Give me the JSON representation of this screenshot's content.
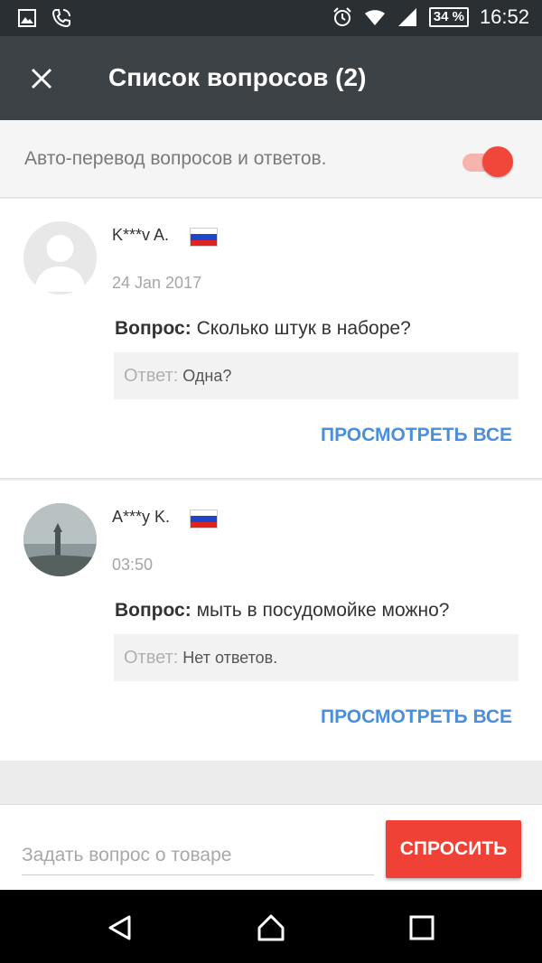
{
  "status_bar": {
    "time": "16:52",
    "battery": "34 %",
    "icons": [
      "image-icon",
      "phone-call-icon",
      "alarm-icon",
      "wifi-icon",
      "signal-icon"
    ]
  },
  "toolbar": {
    "title": "Список вопросов (2)",
    "close_icon": "close-icon"
  },
  "auto_translate": {
    "label": "Авто-перевод вопросов и ответов.",
    "enabled": true,
    "accent": "#f1473b"
  },
  "questions": [
    {
      "author": "K***v A.",
      "country": "Russia",
      "date": "24 Jan 2017",
      "question_label": "Вопрос:",
      "question_text": " Сколько штук в наборе?",
      "answer_label": "Ответ:",
      "answer_text": " Одна?",
      "view_all": "ПРОСМОТРЕТЬ ВСЕ"
    },
    {
      "author": "A***y K.",
      "country": "Russia",
      "date": "03:50",
      "question_label": "Вопрос:",
      "question_text": " мыть в посудомойке можно?",
      "answer_label": "Ответ:",
      "answer_text": " Нет ответов.",
      "view_all": "ПРОСМОТРЕТЬ ВСЕ"
    }
  ],
  "ask": {
    "placeholder": "Задать вопрос о товаре",
    "button": "СПРОСИТЬ",
    "button_color": "#ef4136"
  },
  "nav": {
    "buttons": [
      "back-icon",
      "home-icon",
      "recents-icon"
    ]
  }
}
